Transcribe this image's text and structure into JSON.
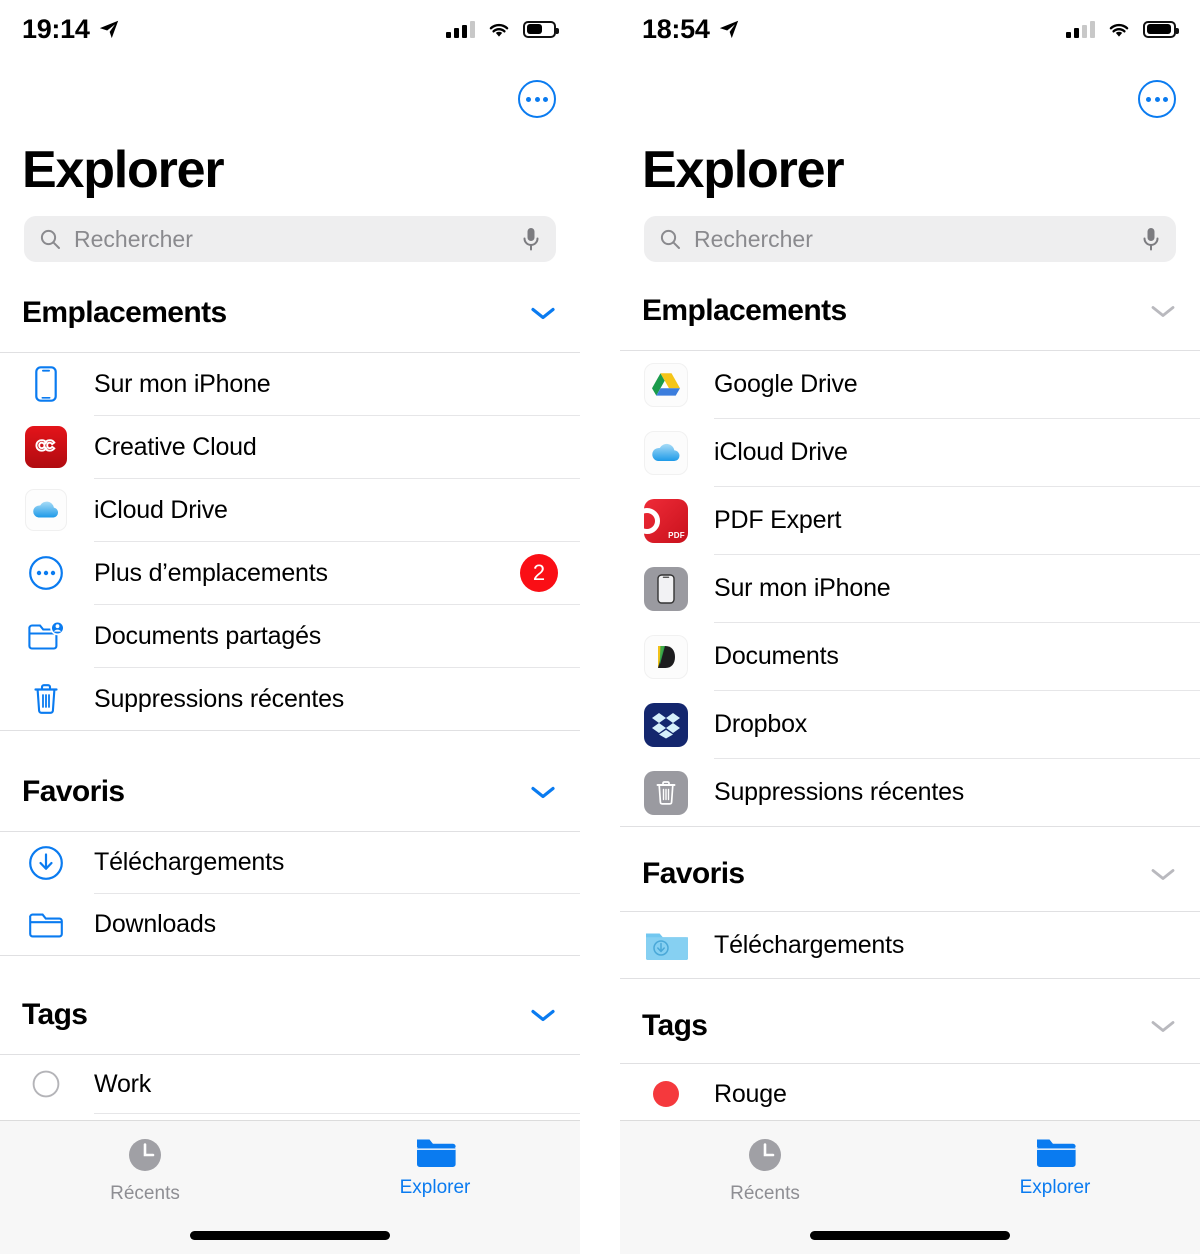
{
  "left": {
    "statusbar": {
      "time": "19:14",
      "location_icon": "location-arrow-icon",
      "signal_bars_filled": 3,
      "signal_bars_total": 4,
      "wifi_icon": "wifi-icon",
      "battery_percent": 55
    },
    "header": {
      "more_button": "more-circle-icon",
      "title": "Explorer"
    },
    "search": {
      "placeholder": "Rechercher",
      "value": "",
      "search_icon": "search-icon",
      "mic_icon": "microphone-icon"
    },
    "sections": [
      {
        "title": "Emplacements",
        "chevron": "chevron-down-icon",
        "chevron_color": "#0a7bf0",
        "items": [
          {
            "label": "Sur mon iPhone",
            "icon": "iphone-outline-icon",
            "badge": ""
          },
          {
            "label": "Creative Cloud",
            "icon": "adobe-creative-cloud-icon",
            "badge": ""
          },
          {
            "label": "iCloud Drive",
            "icon": "icloud-drive-icon",
            "badge": ""
          },
          {
            "label": "Plus d’emplacements",
            "icon": "more-circle-icon",
            "badge": "2"
          },
          {
            "label": "Documents partagés",
            "icon": "shared-folder-icon",
            "badge": ""
          },
          {
            "label": "Suppressions récentes",
            "icon": "trash-outline-icon",
            "badge": ""
          }
        ]
      },
      {
        "title": "Favoris",
        "chevron": "chevron-down-icon",
        "chevron_color": "#0a7bf0",
        "items": [
          {
            "label": "Téléchargements",
            "icon": "download-circle-icon",
            "badge": ""
          },
          {
            "label": "Downloads",
            "icon": "folder-outline-icon",
            "badge": ""
          }
        ]
      },
      {
        "title": "Tags",
        "chevron": "chevron-down-icon",
        "chevron_color": "#0a7bf0",
        "items": [
          {
            "label": "Work",
            "icon": "tag-circle-gray-icon",
            "badge": ""
          }
        ]
      }
    ],
    "tabbar": [
      {
        "label": "Récents",
        "icon": "clock-icon",
        "active": false
      },
      {
        "label": "Explorer",
        "icon": "folder-filled-icon",
        "active": true
      }
    ]
  },
  "right": {
    "statusbar": {
      "time": "18:54",
      "location_icon": "location-arrow-icon",
      "signal_bars_filled": 2,
      "signal_bars_total": 4,
      "wifi_icon": "wifi-icon",
      "battery_percent": 85
    },
    "header": {
      "more_button": "more-circle-icon",
      "title": "Explorer"
    },
    "search": {
      "placeholder": "Rechercher",
      "value": "",
      "search_icon": "search-icon",
      "mic_icon": "microphone-icon"
    },
    "sections": [
      {
        "title": "Emplacements",
        "chevron": "chevron-down-icon",
        "chevron_color": "#b9b9be",
        "items": [
          {
            "label": "Google Drive",
            "icon": "google-drive-icon",
            "badge": ""
          },
          {
            "label": "iCloud Drive",
            "icon": "icloud-drive-icon",
            "badge": ""
          },
          {
            "label": "PDF Expert",
            "icon": "pdf-expert-icon",
            "badge": ""
          },
          {
            "label": "Sur mon iPhone",
            "icon": "iphone-gray-tile-icon",
            "badge": ""
          },
          {
            "label": "Documents",
            "icon": "documents-app-icon",
            "badge": ""
          },
          {
            "label": "Dropbox",
            "icon": "dropbox-icon",
            "badge": ""
          },
          {
            "label": "Suppressions récentes",
            "icon": "trash-gray-tile-icon",
            "badge": ""
          }
        ]
      },
      {
        "title": "Favoris",
        "chevron": "chevron-down-icon",
        "chevron_color": "#b9b9be",
        "items": [
          {
            "label": "Téléchargements",
            "icon": "downloads-folder-blue-icon",
            "badge": ""
          }
        ]
      },
      {
        "title": "Tags",
        "chevron": "chevron-down-icon",
        "chevron_color": "#b9b9be",
        "items": [
          {
            "label": "Rouge",
            "icon": "tag-dot-red-icon",
            "badge": ""
          }
        ]
      }
    ],
    "tabbar": [
      {
        "label": "Récents",
        "icon": "clock-icon",
        "active": false
      },
      {
        "label": "Explorer",
        "icon": "folder-filled-icon",
        "active": true
      }
    ]
  },
  "colors": {
    "accent_blue": "#0a7bf0",
    "badge_red": "#fa0e15",
    "search_bg": "#eeeeef",
    "divider": "#e0e0e2",
    "inactive_gray": "#8e8e93"
  }
}
